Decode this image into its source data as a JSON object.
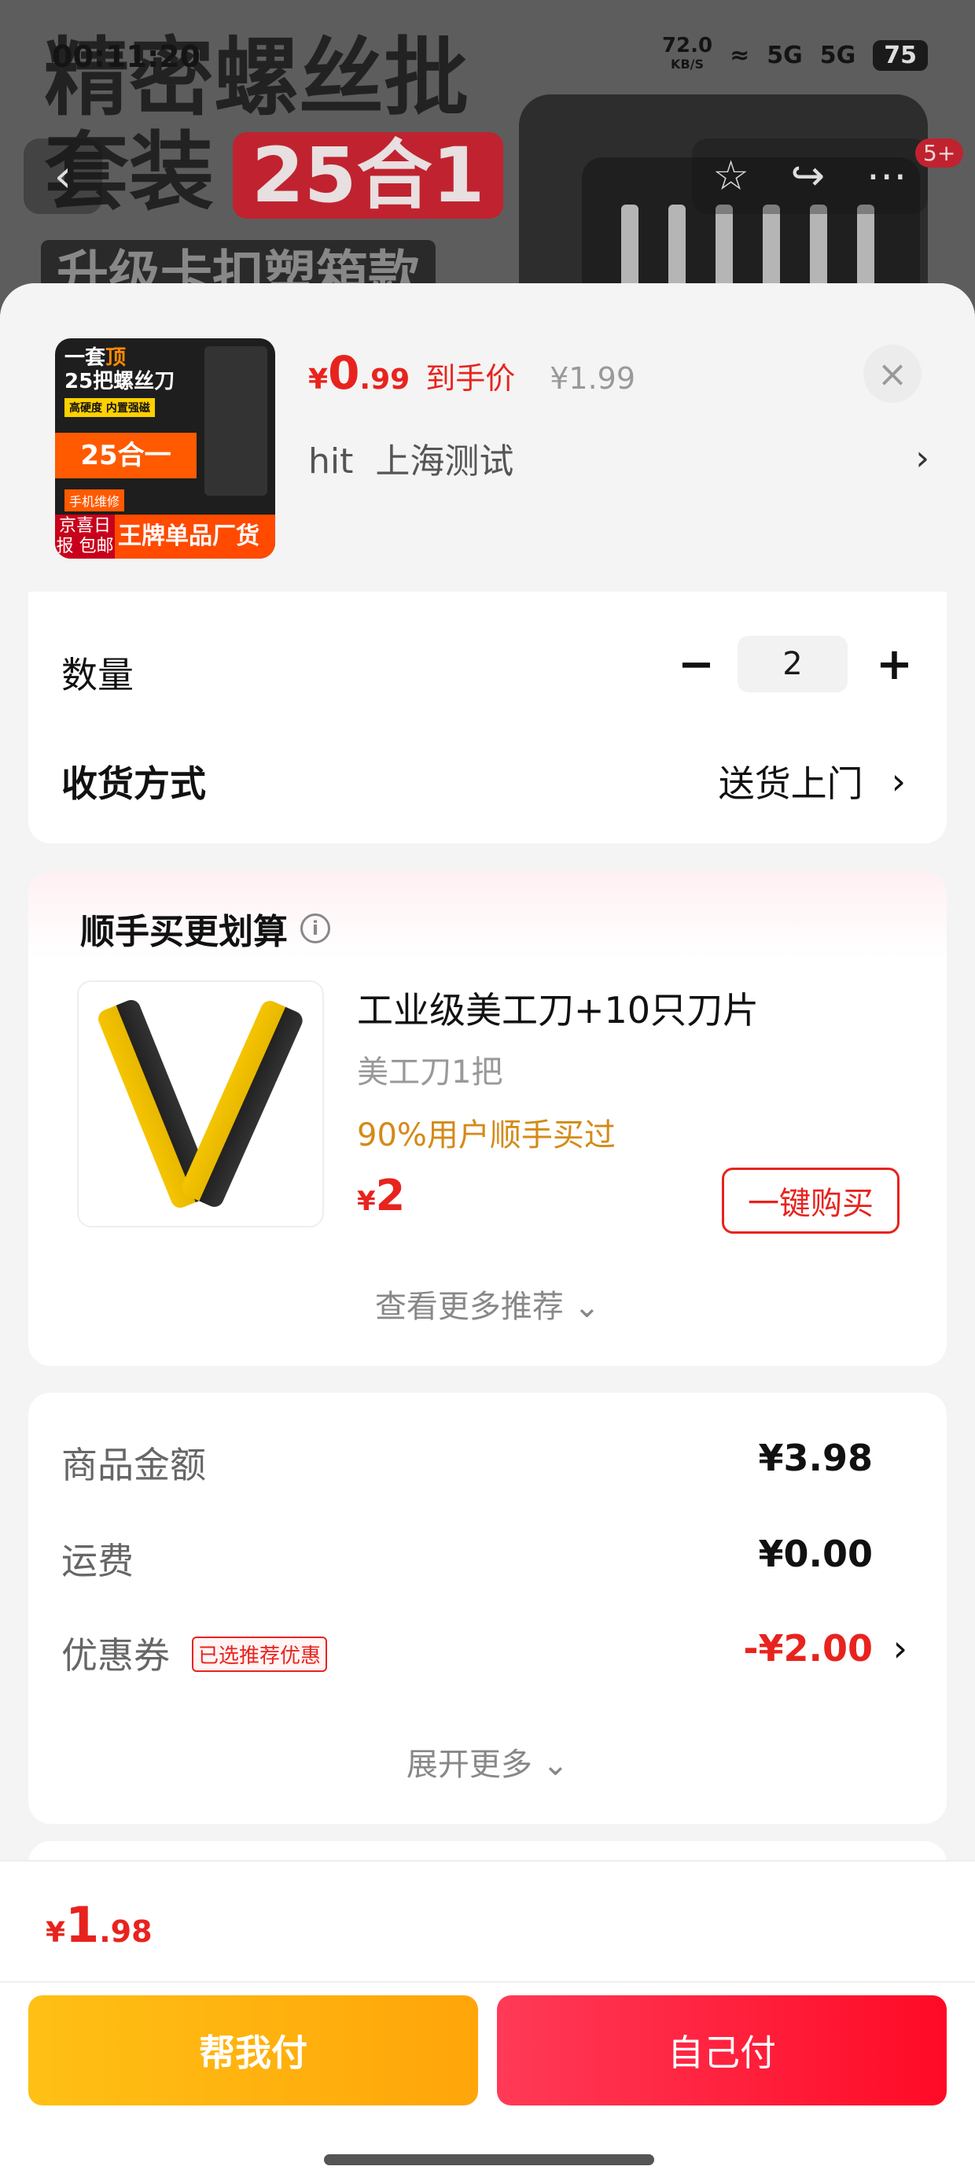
{
  "status_bar": {
    "time": "00:11:20",
    "net_speed": "72.0",
    "net_unit": "KB/S",
    "signal1": "5G",
    "signal2": "5G",
    "battery": "75"
  },
  "background": {
    "headline_line1": "精密螺丝批",
    "headline_line2": "套装",
    "badge": "25合1",
    "sub": "升级卡扣塑箱款"
  },
  "nav": {
    "back_icon": "back-arrow-icon",
    "message_badge": "5+"
  },
  "product": {
    "thumb": {
      "line1": "一套",
      "line1_hl": "顶",
      "line2": "25把螺丝刀",
      "tag1": "高硬度 内置强磁",
      "band": "25合一",
      "tag2": "手机维修",
      "bottom_text": "王牌单品厂货百补",
      "bottom_left": "京喜日报 包邮"
    },
    "price_symbol": "¥",
    "price_int": "0",
    "price_dec": ".99",
    "price_tag": "到手价",
    "original_price": "¥1.99",
    "address_prefix": "hit",
    "address": "上海测试"
  },
  "options": {
    "quantity_label": "数量",
    "quantity": "2",
    "minus": "−",
    "plus": "+",
    "delivery_label": "收货方式",
    "delivery_value": "送货上门"
  },
  "upsell": {
    "title": "顺手买更划算",
    "info": "i",
    "name": "工业级美工刀+10只刀片",
    "spec": "美工刀1把",
    "social": "90%用户顺手买过",
    "price_symbol": "¥",
    "price": "2",
    "buy_label": "一键购买",
    "more": "查看更多推荐 ⌄"
  },
  "summary": {
    "goods_label": "商品金额",
    "goods_value": "¥3.98",
    "shipping_label": "运费",
    "shipping_value": "¥0.00",
    "coupon_label": "优惠券",
    "coupon_tag": "已选推荐优惠",
    "coupon_value": "-¥2.00",
    "expand": "展开更多 ⌄"
  },
  "footer": {
    "total_symbol": "¥",
    "total_int": "1",
    "total_dec": ".98",
    "help_pay": "帮我付",
    "self_pay": "自己付"
  },
  "colors": {
    "accent_red": "#e8231e",
    "help_pay_yellow": "#ffb00f",
    "self_pay_red": "#ff1f3d",
    "social_orange": "#d48a18"
  }
}
